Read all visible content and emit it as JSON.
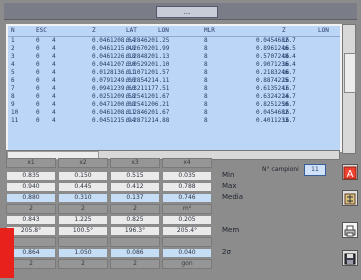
{
  "title": "...",
  "table": {
    "columns": [
      "N",
      "ESC",
      "Z",
      "LAT",
      "LON",
      "MLR",
      "",
      "Z",
      "LON"
    ],
    "rows": [
      {
        "n": "1",
        "a": "0",
        "b": "4",
        "c": "0.0461208.64",
        "d": "0.2846201.25",
        "e": "",
        "f": "8",
        "g": "0.0454682.7",
        "h": "16"
      },
      {
        "n": "2",
        "a": "0",
        "b": "4",
        "c": "0.0461215.48",
        "d": "0.2670201.99",
        "e": "",
        "f": "8",
        "g": "0.8961246.5",
        "h": "16"
      },
      {
        "n": "3",
        "a": "0",
        "b": "4",
        "c": "0.0461226.18",
        "d": "0.2848201.13",
        "e": "",
        "f": "8",
        "g": "0.5707248.4",
        "h": "16"
      },
      {
        "n": "4",
        "a": "0",
        "b": "4",
        "c": "0.0441207.30",
        "d": "0.0529201.10",
        "e": "",
        "f": "8",
        "g": "0.9071236.4",
        "h": "16"
      },
      {
        "n": "5",
        "a": "0",
        "b": "4",
        "c": "0.0128136.11",
        "d": "0.1071201.57",
        "e": "",
        "f": "8",
        "g": "0.2183246.7",
        "h": "16"
      },
      {
        "n": "6",
        "a": "0",
        "b": "4",
        "c": "0.0791249.00",
        "d": "0.2854214.11",
        "e": "",
        "f": "8",
        "g": "0.8874225.7",
        "h": "16"
      },
      {
        "n": "7",
        "a": "0",
        "b": "4",
        "c": "0.0941239.60",
        "d": "0.3211177.51",
        "e": "",
        "f": "8",
        "g": "0.6135241.7",
        "h": "16"
      },
      {
        "n": "8",
        "a": "0",
        "b": "4",
        "c": "0.0251209.58",
        "d": "0.2541201.67",
        "e": "",
        "f": "8",
        "g": "0.6324224.7",
        "h": "16"
      },
      {
        "n": "9",
        "a": "0",
        "b": "4",
        "c": "0.0471200.08",
        "d": "0.2541206.21",
        "e": "",
        "f": "8",
        "g": "0.8251250.7",
        "h": "16"
      },
      {
        "n": "10",
        "a": "0",
        "b": "4",
        "c": "0.0461208.11",
        "d": "0.2846201.67",
        "e": "",
        "f": "8",
        "g": "0.0454682.7",
        "h": "16"
      },
      {
        "n": "11",
        "a": "0",
        "b": "4",
        "c": "0.0451215.94",
        "d": "0.2871214.88",
        "e": "",
        "f": "8",
        "g": "0.4011233.7",
        "h": "16"
      }
    ]
  },
  "stats": {
    "columns": [
      "x1",
      "x2",
      "x3",
      "x4"
    ],
    "rows": [
      {
        "label": "Min",
        "cells": [
          "0.835",
          "0.150",
          "0.515",
          "0.035"
        ],
        "style": "gray"
      },
      {
        "label": "Max",
        "cells": [
          "0.940",
          "0.445",
          "0.412",
          "0.788"
        ],
        "style": "gray"
      },
      {
        "label": "Media",
        "cells": [
          "0.880",
          "0.310",
          "0.137",
          "0.746"
        ],
        "style": "blue"
      },
      {
        "label": "",
        "cells": [
          "2",
          "2",
          "2",
          "m²"
        ],
        "style": "hdr"
      },
      {
        "label": "",
        "cells": [
          "0.843",
          "1.225",
          "0.825",
          "0.205"
        ],
        "style": "gray"
      },
      {
        "label": "Mem",
        "cells": [
          "205.8°",
          "100.5°",
          "196.3°",
          "205.4°"
        ],
        "style": "gray"
      },
      {
        "label": "",
        "cells": [
          "",
          "",
          "",
          ""
        ],
        "style": "hdr"
      },
      {
        "label": "2σ",
        "cells": [
          "0.864",
          "1.050",
          "0.086",
          "0.040"
        ],
        "style": "blue"
      },
      {
        "label": "",
        "cells": [
          "2",
          "2",
          "2",
          "gon"
        ],
        "style": "hdr"
      }
    ],
    "ncampo_label": "N° campioni",
    "ncampo_value": "11"
  },
  "toolbar": {
    "icons": [
      "a-label-icon",
      "calculator-icon",
      "printer-icon",
      "save-icon"
    ],
    "accent": "#e8211c"
  }
}
